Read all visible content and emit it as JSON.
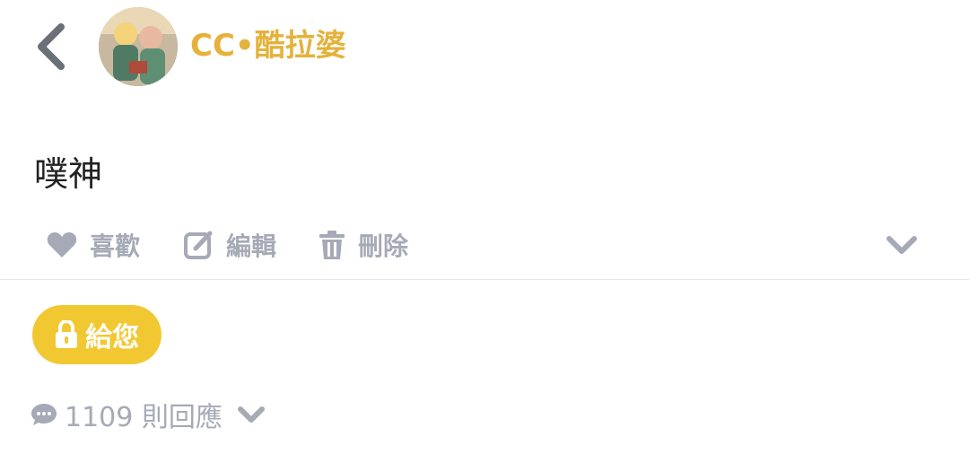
{
  "header": {
    "user_name": "CC•酷拉婆",
    "back_icon": "chevron-left-icon",
    "avatar_icon": "avatar-image"
  },
  "post": {
    "text": "噗神"
  },
  "actions": {
    "like_label": "喜歡",
    "edit_label": "編輯",
    "delete_label": "刪除",
    "like_icon": "heart-icon",
    "edit_icon": "edit-icon",
    "delete_icon": "trash-icon",
    "more_icon": "chevron-down-icon"
  },
  "privacy": {
    "label": "給您",
    "icon": "lock-icon"
  },
  "replies": {
    "label": "1109 則回應",
    "icon": "comment-icon",
    "expand_icon": "chevron-down-icon"
  },
  "colors": {
    "username": "#e4b23c",
    "badge": "#f2c832",
    "muted": "#a6aab7",
    "icon_gray": "#6b6f78",
    "text": "#222222"
  }
}
